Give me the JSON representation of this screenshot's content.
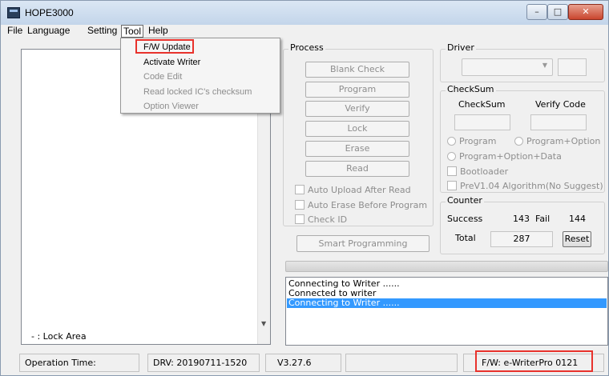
{
  "window": {
    "title": "HOPE3000",
    "controls": {
      "minimize": "–",
      "maximize": "□",
      "close": "✕"
    }
  },
  "menubar": {
    "items": [
      "File",
      "Language",
      "Setting",
      "Tool",
      "Help"
    ],
    "active": "Tool"
  },
  "tool_menu": {
    "items": [
      {
        "label": "F/W Update",
        "enabled": true,
        "highlighted": true
      },
      {
        "label": "Activate Writer",
        "enabled": true
      },
      {
        "label": "Code Edit",
        "enabled": false
      },
      {
        "label": "Read locked IC's checksum",
        "enabled": false
      },
      {
        "label": "Option Viewer",
        "enabled": false
      }
    ]
  },
  "left_panel": {
    "footer": "- : Lock Area"
  },
  "process": {
    "title": "Process",
    "buttons": [
      "Blank Check",
      "Program",
      "Verify",
      "Lock",
      "Erase",
      "Read"
    ],
    "options": [
      {
        "label": "Auto Upload After Read",
        "checked": false
      },
      {
        "label": "Auto Erase Before Program",
        "checked": false
      },
      {
        "label": "Check ID",
        "checked": false
      }
    ],
    "smart_button": "Smart Programming"
  },
  "driver": {
    "title": "Driver",
    "selected": "",
    "extra": ""
  },
  "checksum": {
    "title": "CheckSum",
    "col_checksum": "CheckSum",
    "col_verify": "Verify Code",
    "checksum_value": "",
    "verify_value": "",
    "radio_program": "Program",
    "radio_program_option": "Program+Option",
    "radio_program_option_data": "Program+Option+Data",
    "bootloader": "Bootloader",
    "prev104": "PreV1.04 Algorithm(No Suggest)"
  },
  "counter": {
    "title": "Counter",
    "success_label": "Success",
    "success_value": "143",
    "fail_label": "Fail",
    "fail_value": "144",
    "total_label": "Total",
    "total_value": "287",
    "reset_label": "Reset"
  },
  "progress": {
    "percent": 0
  },
  "log": {
    "lines": [
      "Connecting to Writer ......",
      "Connected to writer",
      "Connecting to Writer ......"
    ],
    "selected_index": 2
  },
  "statusbar": {
    "operation_time": "Operation Time:",
    "drv": "DRV: 20190711-1520",
    "version": "V3.27.6",
    "empty": "",
    "fw": "F/W: e-WriterPro 0121"
  },
  "colors": {
    "highlight_red": "#e8322c",
    "selection_blue": "#3399ff"
  }
}
